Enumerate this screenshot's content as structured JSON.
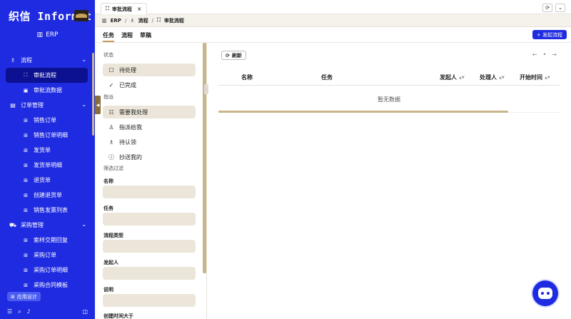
{
  "sidebar": {
    "logo": "织信 Informat",
    "org": "ERP",
    "groups": [
      {
        "label": "流程",
        "items": [
          "审批流程",
          "审批流数据"
        ]
      },
      {
        "label": "订单管理",
        "items": [
          "销售订单",
          "销售订单明细",
          "发货单",
          "发货单明细",
          "退货单",
          "创建退货单",
          "销售发票列表"
        ]
      },
      {
        "label": "采购管理",
        "items": [
          "索样交期回复",
          "采购订单",
          "采购订单明细",
          "采购合同模板"
        ]
      }
    ],
    "app_design": "应用设计"
  },
  "topbar": {
    "tab_label": "审批流程",
    "tab_close": "×",
    "refresh_icon": "⟳",
    "menu_icon": "⌄"
  },
  "breadcrumb": [
    "ERP",
    "流程",
    "审批流程"
  ],
  "subheader": {
    "tabs": [
      "任务",
      "流程",
      "草稿"
    ],
    "active_tab": "任务",
    "start_button": "+ 发起流程"
  },
  "filter": {
    "status_label": "状态",
    "status_items": [
      "待处理",
      "已完成"
    ],
    "assign_label": "指派",
    "assign_items": [
      "需要我处理",
      "指派给我",
      "待认领",
      "抄送我的"
    ],
    "filter_label": "筛选过滤",
    "fields": [
      "名称",
      "任务",
      "流程类型",
      "发起人",
      "说明",
      "创建时间大于"
    ]
  },
  "main": {
    "refresh_button": "刷新",
    "pager": [
      "←",
      "•",
      "→"
    ],
    "columns": [
      "名称",
      "任务",
      "发起人",
      "处理人",
      "开始时间"
    ],
    "empty_text": "暂无数据"
  },
  "colors": {
    "sidebar": "#1f2be0",
    "active_nav": "#0b1190",
    "accent": "#c49a5a",
    "selected_bg": "#ece6da"
  }
}
